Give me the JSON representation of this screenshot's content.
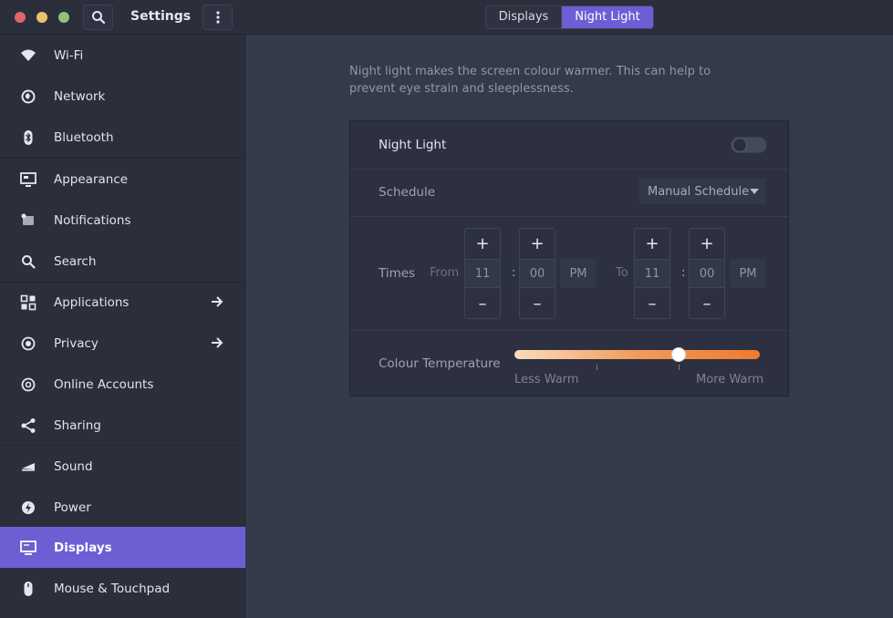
{
  "header": {
    "title": "Settings",
    "tabs": [
      {
        "label": "Displays",
        "active": false
      },
      {
        "label": "Night Light",
        "active": true
      }
    ],
    "icons": [
      "search-icon",
      "more-vertical-icon"
    ]
  },
  "sidebar": {
    "items": [
      {
        "label": "Wi-Fi",
        "icon": "wifi-icon"
      },
      {
        "label": "Network",
        "icon": "network-icon"
      },
      {
        "label": "Bluetooth",
        "icon": "bluetooth-icon"
      },
      {
        "label": "Appearance",
        "icon": "appearance-icon"
      },
      {
        "label": "Notifications",
        "icon": "notifications-icon"
      },
      {
        "label": "Search",
        "icon": "search-icon"
      },
      {
        "label": "Applications",
        "icon": "applications-icon"
      },
      {
        "label": "Privacy",
        "icon": "privacy-icon"
      },
      {
        "label": "Online Accounts",
        "icon": "online-accounts-icon"
      },
      {
        "label": "Sharing",
        "icon": "sharing-icon"
      },
      {
        "label": "Sound",
        "icon": "sound-icon"
      },
      {
        "label": "Power",
        "icon": "power-icon"
      },
      {
        "label": "Displays",
        "icon": "displays-icon",
        "active": true
      },
      {
        "label": "Mouse & Touchpad",
        "icon": "mouse-icon"
      }
    ]
  },
  "content": {
    "description": "Night light makes the screen colour warmer. This can help to prevent eye strain and sleeplessness.",
    "night_light": {
      "label": "Night Light",
      "enabled": false
    },
    "schedule": {
      "label": "Schedule",
      "value": "Manual Schedule"
    },
    "times": {
      "label": "Times",
      "from_label": "From",
      "to_label": "To",
      "separator": ":",
      "plus": "+",
      "minus": "–",
      "from": {
        "hour": "11",
        "minute": "00",
        "period": "PM"
      },
      "to": {
        "hour": "11",
        "minute": "00",
        "period": "PM"
      }
    },
    "colour_temperature": {
      "label": "Colour Temperature",
      "min_label": "Less Warm",
      "max_label": "More Warm",
      "value_fraction": 0.67
    }
  },
  "colors": {
    "accent": "#6e5ed4",
    "sidebar_bg": "#2b2f3c",
    "content_bg": "#353a4a"
  }
}
